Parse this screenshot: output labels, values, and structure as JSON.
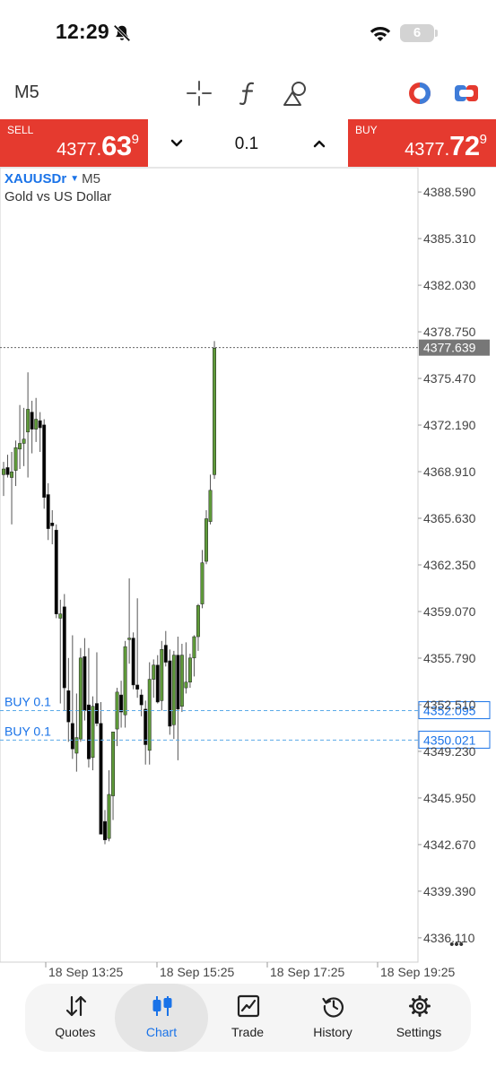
{
  "status_bar": {
    "time": "12:29",
    "battery": "6"
  },
  "toolbar": {
    "timeframe": "M5"
  },
  "trade": {
    "sell_label": "SELL",
    "sell_price_main": "4377.",
    "sell_price_big": "63",
    "sell_price_sup": "9",
    "buy_label": "BUY",
    "buy_price_main": "4377.",
    "buy_price_big": "72",
    "buy_price_sup": "9",
    "lot_size": "0.1"
  },
  "chart": {
    "symbol": "XAUUSDr",
    "timeframe": "M5",
    "description": "Gold vs US Dollar",
    "more": "•••"
  },
  "chart_data": {
    "type": "candlestick",
    "ylim": [
      4334.4,
      4390.3
    ],
    "y_ticks": [
      "4388.590",
      "4385.310",
      "4382.030",
      "4378.750",
      "4375.470",
      "4372.190",
      "4368.910",
      "4365.630",
      "4362.350",
      "4359.070",
      "4355.790",
      "4352.510",
      "4349.230",
      "4345.950",
      "4342.670",
      "4339.390",
      "4336.110"
    ],
    "x_ticks": [
      "18 Sep 13:25",
      "18 Sep 15:25",
      "18 Sep 17:25",
      "18 Sep 19:25"
    ],
    "current_price": "4377.639",
    "current_price_value": 4377.639,
    "orders": [
      {
        "label": "BUY 0.1",
        "price": "4352.095",
        "value": 4352.095
      },
      {
        "label": "BUY 0.1",
        "price": "4350.021",
        "value": 4350.021
      }
    ],
    "colors": {
      "up": "#5f9a3a",
      "down": "#000000",
      "line": "#5aaae8",
      "badge": "#1a73e8",
      "current_badge": "#777777"
    },
    "candles": [
      [
        4368.7,
        4369.6,
        4367.2,
        4369.1
      ],
      [
        4369.2,
        4370.1,
        4368.5,
        4368.7
      ],
      [
        4368.5,
        4370.3,
        4365.2,
        4368.9
      ],
      [
        4369.0,
        4371.1,
        4367.9,
        4370.6
      ],
      [
        4370.5,
        4373.6,
        4369.1,
        4370.9
      ],
      [
        4370.9,
        4373.4,
        4369.3,
        4371.2
      ],
      [
        4371.7,
        4375.9,
        4368.5,
        4373.3
      ],
      [
        4373.1,
        4373.9,
        4370.2,
        4371.9
      ],
      [
        4371.9,
        4374.1,
        4371.0,
        4372.6
      ],
      [
        4372.5,
        4373.1,
        4370.3,
        4372.0
      ],
      [
        4372.2,
        4372.6,
        4366.3,
        4367.1
      ],
      [
        4367.3,
        4368.1,
        4364.1,
        4364.9
      ],
      [
        4365.3,
        4366.2,
        4363.8,
        4365.1
      ],
      [
        4364.8,
        4365.2,
        4358.6,
        4358.9
      ],
      [
        4358.6,
        4359.9,
        4352.6,
        4358.9
      ],
      [
        4359.4,
        4360.3,
        4352.1,
        4353.7
      ],
      [
        4353.5,
        4355.8,
        4349.9,
        4351.3
      ],
      [
        4351.2,
        4357.4,
        4348.7,
        4349.4
      ],
      [
        4349.1,
        4353.3,
        4347.8,
        4350.2
      ],
      [
        4350.1,
        4356.5,
        4349.9,
        4355.8
      ],
      [
        4355.9,
        4357.2,
        4351.4,
        4352.1
      ],
      [
        4352.5,
        4356.5,
        4348.1,
        4348.7
      ],
      [
        4348.8,
        4353.1,
        4347.9,
        4352.4
      ],
      [
        4352.6,
        4356.2,
        4351.0,
        4351.2
      ],
      [
        4351.2,
        4352.7,
        4344.0,
        4343.4
      ],
      [
        4344.3,
        4345.1,
        4342.7,
        4343.0
      ],
      [
        4343.1,
        4347.9,
        4342.9,
        4346.2
      ],
      [
        4346.1,
        4350.6,
        4344.4,
        4350.6
      ],
      [
        4350.8,
        4353.7,
        4349.6,
        4353.4
      ],
      [
        4353.2,
        4354.2,
        4350.9,
        4352.0
      ],
      [
        4351.8,
        4357.0,
        4350.9,
        4356.6
      ],
      [
        4357.1,
        4361.4,
        4355.4,
        4357.2
      ],
      [
        4357.2,
        4357.6,
        4353.6,
        4353.9
      ],
      [
        4353.9,
        4360.0,
        4353.0,
        4353.6
      ],
      [
        4353.2,
        4353.6,
        4351.7,
        4352.5
      ],
      [
        4352.2,
        4352.8,
        4348.3,
        4349.7
      ],
      [
        4349.3,
        4355.5,
        4348.3,
        4354.3
      ],
      [
        4354.3,
        4355.7,
        4353.0,
        4355.3
      ],
      [
        4355.3,
        4356.0,
        4352.6,
        4352.7
      ],
      [
        4352.8,
        4357.0,
        4352.1,
        4356.4
      ],
      [
        4356.7,
        4357.7,
        4355.2,
        4355.5
      ],
      [
        4355.6,
        4356.4,
        4350.4,
        4351.0
      ],
      [
        4351.1,
        4356.3,
        4350.1,
        4356.0
      ],
      [
        4356.0,
        4357.3,
        4348.6,
        4352.2
      ],
      [
        4352.4,
        4356.8,
        4352.0,
        4356.0
      ],
      [
        4353.7,
        4356.9,
        4353.3,
        4354.1
      ],
      [
        4354.1,
        4356.1,
        4353.7,
        4355.8
      ],
      [
        4355.8,
        4357.4,
        4354.5,
        4357.3
      ],
      [
        4357.3,
        4359.6,
        4356.3,
        4359.5
      ],
      [
        4359.6,
        4363.4,
        4359.3,
        4362.5
      ],
      [
        4362.6,
        4366.2,
        4362.4,
        4365.6
      ],
      [
        4365.4,
        4368.7,
        4365.2,
        4367.6
      ],
      [
        4368.7,
        4378.1,
        4368.4,
        4377.6
      ]
    ]
  },
  "nav": {
    "items": [
      {
        "label": "Quotes"
      },
      {
        "label": "Chart"
      },
      {
        "label": "Trade"
      },
      {
        "label": "History"
      },
      {
        "label": "Settings"
      }
    ]
  }
}
